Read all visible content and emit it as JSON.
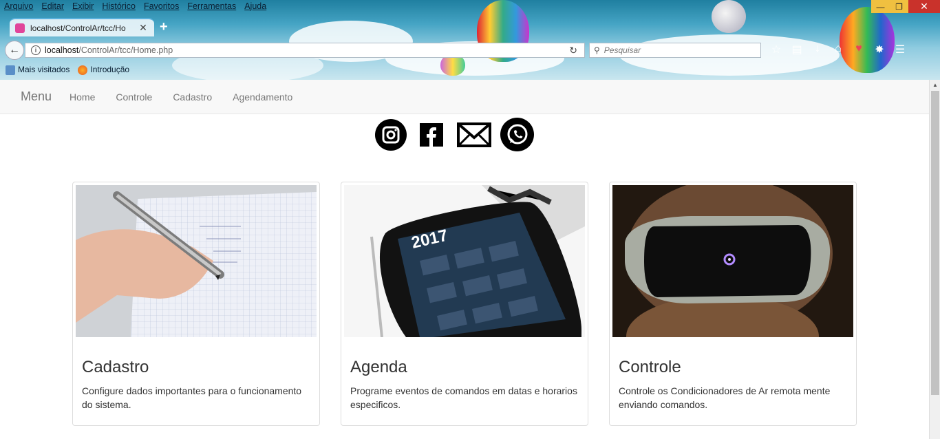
{
  "browser": {
    "menu": [
      "Arquivo",
      "Editar",
      "Exibir",
      "Histórico",
      "Favoritos",
      "Ferramentas",
      "Ajuda"
    ],
    "tab_title": "localhost/ControlAr/tcc/Ho",
    "url_host": "localhost",
    "url_path": "/ControlAr/tcc/Home.php",
    "search_placeholder": "Pesquisar",
    "bookmarks": [
      "Mais visitados",
      "Introdução"
    ]
  },
  "navbar": {
    "brand": "Menu",
    "links": [
      "Home",
      "Controle",
      "Cadastro",
      "Agendamento"
    ]
  },
  "social_icons": [
    "instagram-icon",
    "facebook-icon",
    "mail-icon",
    "whatsapp-icon"
  ],
  "cards": [
    {
      "title": "Cadastro",
      "text": "Configure dados importantes para o funcionamento do sistema."
    },
    {
      "title": "Agenda",
      "text": "Programe eventos de comandos em datas e horarios especificos."
    },
    {
      "title": "Controle",
      "text": "Controle os Condicionadores de Ar remota mente enviando comandos."
    }
  ],
  "calendar_year": "2017",
  "colors": {
    "navbar_bg": "#f8f8f8",
    "link": "#777777",
    "card_border": "#dddddd",
    "text": "#333333",
    "tab_accent": "#58b0dc"
  }
}
